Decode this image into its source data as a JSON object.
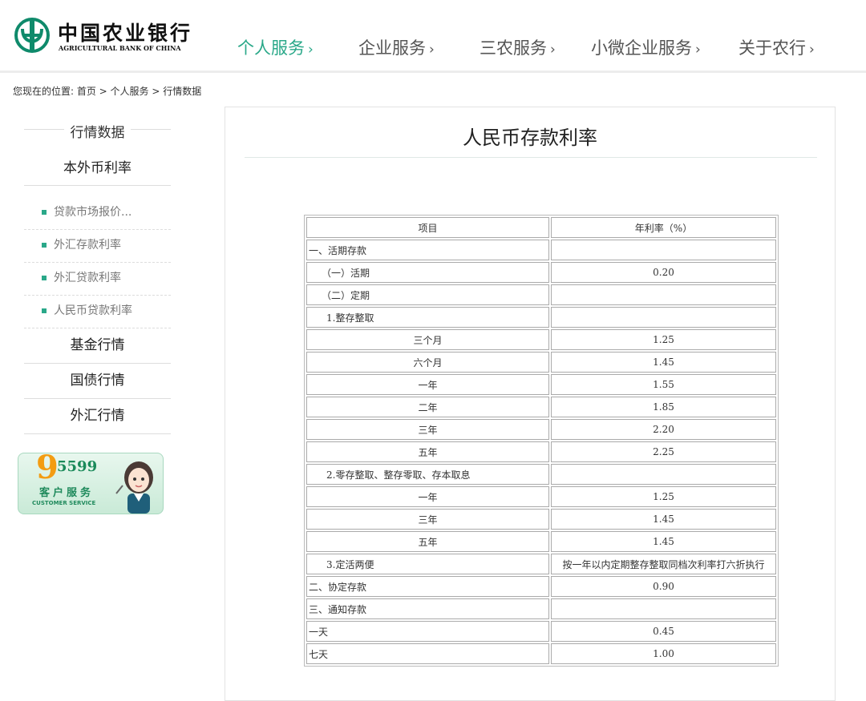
{
  "logo": {
    "cn": "中国农业银行",
    "en": "AGRICULTURAL BANK OF CHINA"
  },
  "nav": [
    {
      "label": "个人服务",
      "arrow": "›"
    },
    {
      "label": "企业服务",
      "arrow": "›"
    },
    {
      "label": "三农服务",
      "arrow": "›"
    },
    {
      "label": "小微企业服务",
      "arrow": "›"
    },
    {
      "label": "关于农行",
      "arrow": "›"
    }
  ],
  "colors": {
    "accent": "#2aa889",
    "text": "#333333"
  },
  "breadcrumb": "您现在的位置: 首页 > 个人服务 > 行情数据",
  "sidebar": {
    "heading": "行情数据",
    "cat1": "本外币利率",
    "subs": [
      "贷款市场报价...",
      "外汇存款利率",
      "外汇贷款利率",
      "人民币贷款利率"
    ],
    "cat2": "基金行情",
    "cat3": "国债行情",
    "cat4": "外汇行情"
  },
  "banner": {
    "number_big": "9",
    "number_small": "5599",
    "cn": "客户服务",
    "en": "CUSTOMER SERVICE"
  },
  "main": {
    "title": "人民币存款利率"
  },
  "table": {
    "headers": [
      "项目",
      "年利率（%）"
    ],
    "rows": [
      [
        "一、活期存款",
        ""
      ],
      [
        "（一）活期",
        "0.20"
      ],
      [
        "（二）定期",
        ""
      ],
      [
        "1.整存整取",
        ""
      ],
      [
        "三个月",
        "1.25"
      ],
      [
        "六个月",
        "1.45"
      ],
      [
        "一年",
        "1.55"
      ],
      [
        "二年",
        "1.85"
      ],
      [
        "三年",
        "2.20"
      ],
      [
        "五年",
        "2.25"
      ],
      [
        "2.零存整取、整存零取、存本取息",
        ""
      ],
      [
        "一年",
        "1.25"
      ],
      [
        "三年",
        "1.45"
      ],
      [
        "五年",
        "1.45"
      ],
      [
        "3.定活两便",
        "按一年以内定期整存整取同档次利率打六折执行"
      ],
      [
        "二、协定存款",
        "0.90"
      ],
      [
        "三、通知存款",
        ""
      ],
      [
        "一天",
        "0.45"
      ],
      [
        "七天",
        "1.00"
      ]
    ]
  }
}
